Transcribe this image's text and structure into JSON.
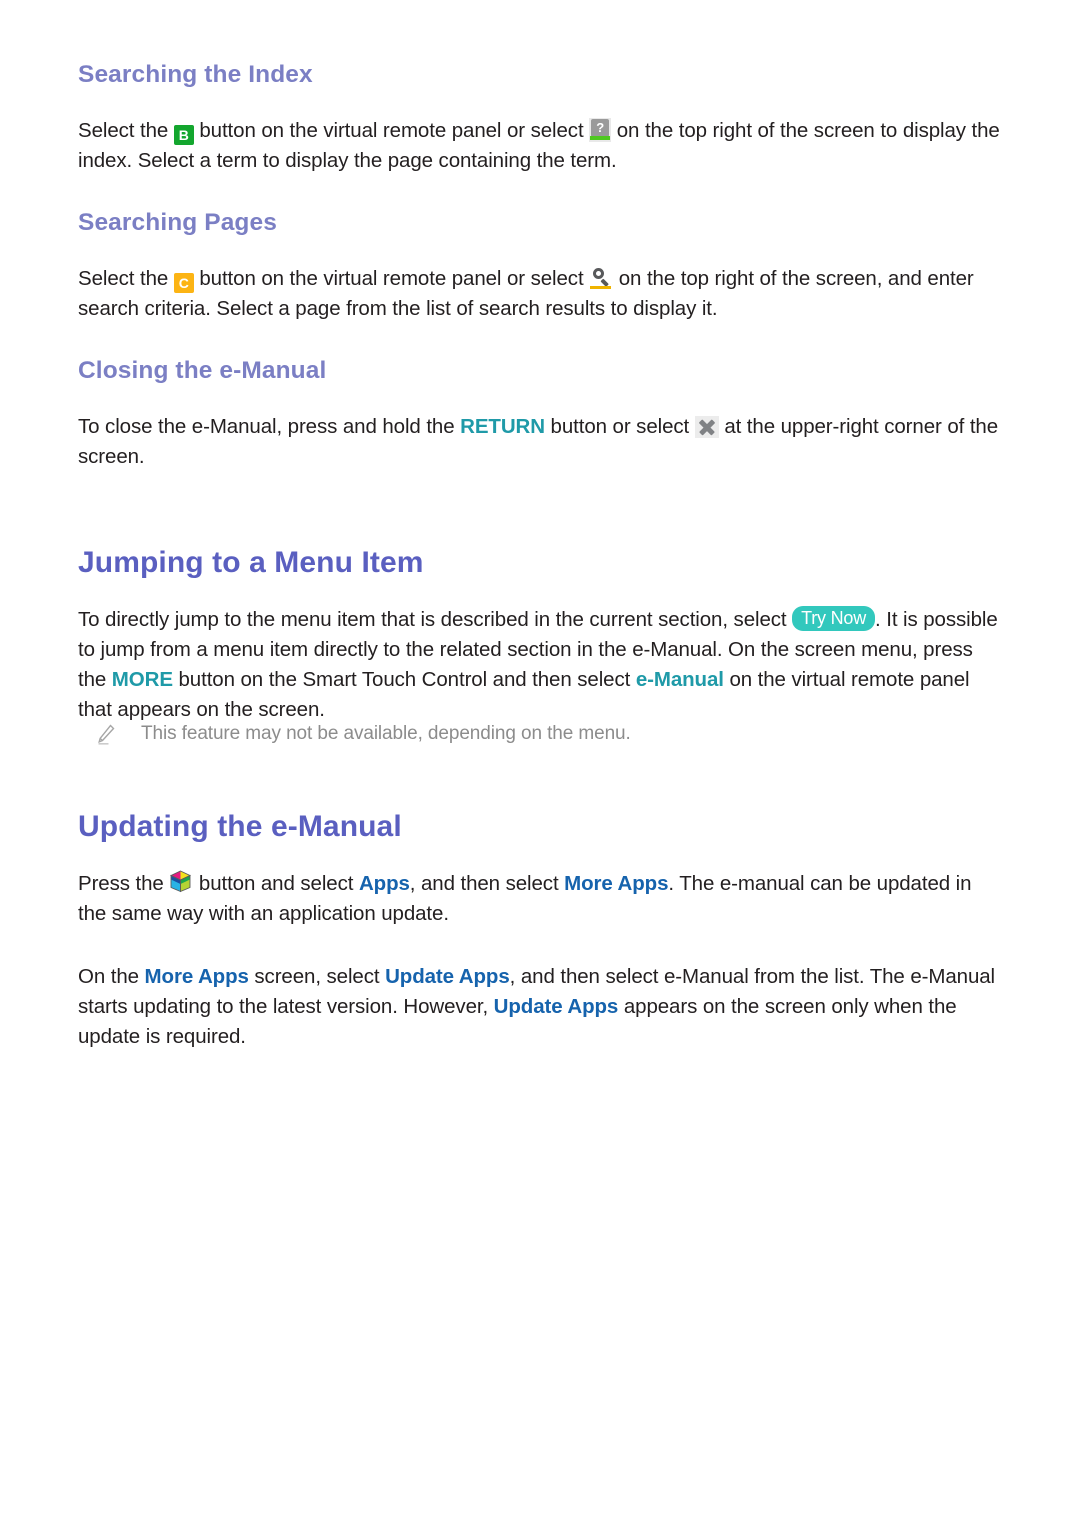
{
  "page": {
    "background_color": "#ffffff",
    "text_color": "#231f20",
    "sub_heading_color": "#7b7fc4",
    "main_heading_color": "#5a5fc0",
    "link_teal_color": "#1f9aa8",
    "link_blue_color": "#1663ad",
    "badge_color": "#32c8bd"
  },
  "sections": {
    "searching_index": {
      "heading": "Searching the Index",
      "body_part1": "Select the ",
      "chip_b": "B",
      "body_part2": " button on the virtual remote panel or select ",
      "body_part3": " on the top right of the screen to display the index. Select a term to display the page containing the term."
    },
    "searching_pages": {
      "heading": "Searching Pages",
      "body_part1": "Select the ",
      "chip_c": "C",
      "body_part2": " button on the virtual remote panel or select ",
      "body_part3": " on the top right of the screen, and enter search criteria. Select a page from the list of search results to display it."
    },
    "closing_emanual": {
      "heading": "Closing the e-Manual",
      "body_part1": "To close the e-Manual, press and hold the ",
      "link_return": "RETURN",
      "body_part2": " button or select ",
      "body_part3": " at the upper-right corner of the screen."
    },
    "jumping_menu": {
      "heading": "Jumping to a Menu Item",
      "body_part1": "To directly jump to the menu item that is described in the current section, select ",
      "badge_try_now": "Try Now",
      "body_part2": ". It is possible to jump from a menu item directly to the related section in the e-Manual. On the screen menu, press the ",
      "link_more": "MORE",
      "body_part3": " button on the Smart Touch Control and then select ",
      "link_emanual": "e-Manual",
      "body_part4": " on the virtual remote panel that appears on the screen.",
      "note": "This feature may not be available, depending on the menu."
    },
    "updating_emanual": {
      "heading": "Updating the e-Manual",
      "p1_part1": "Press the ",
      "p1_part2": " button and select ",
      "p1_link_apps": "Apps",
      "p1_part3": ", and then select ",
      "p1_link_more_apps": "More Apps",
      "p1_part4": ". The e-manual can be updated in the same way with an application update.",
      "p2_part1": "On the ",
      "p2_link_more_apps": "More Apps",
      "p2_part2": " screen, select ",
      "p2_link_update_apps": "Update Apps",
      "p2_part3": ", and then select e-Manual from the list. The e-Manual starts updating to the latest version. However, ",
      "p2_link_update_apps_2": "Update Apps",
      "p2_part4": " appears on the screen only when the update is required."
    }
  },
  "icons": {
    "index_icon": "index-notebook-question-icon",
    "search_icon": "search-magnifier-icon",
    "close_icon": "close-x-icon",
    "cube_icon": "smart-hub-cube-icon",
    "note_icon": "pencil-note-icon"
  }
}
